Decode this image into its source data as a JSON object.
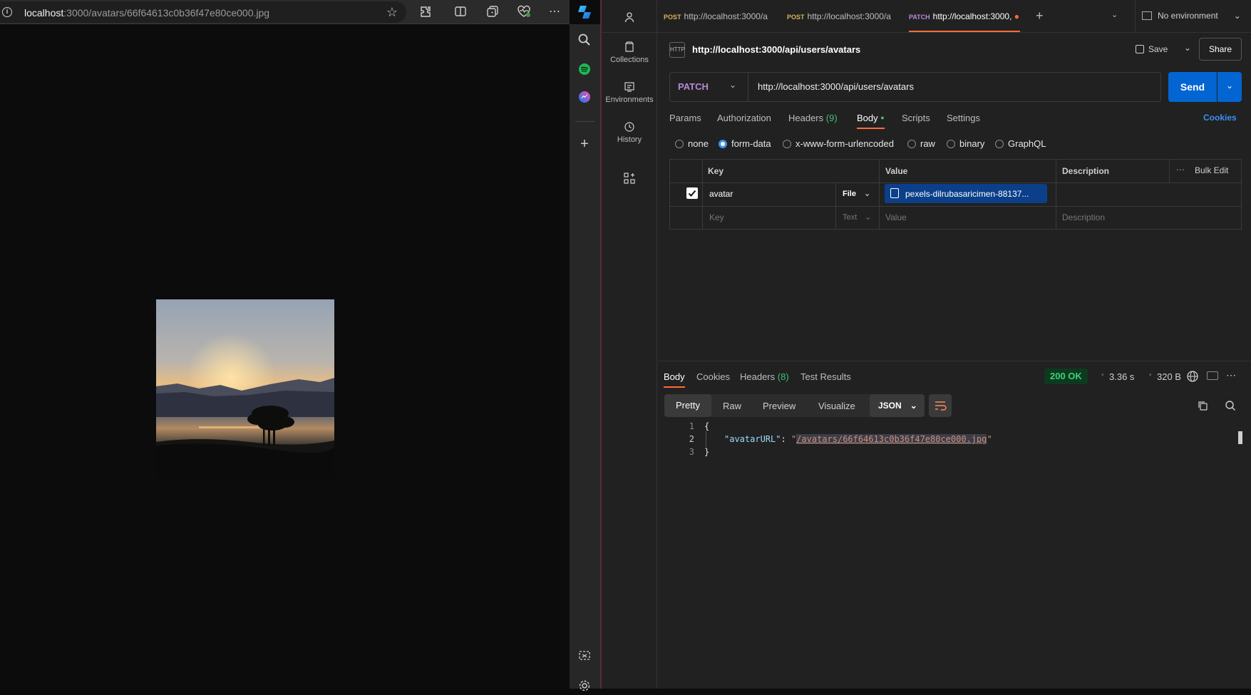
{
  "browser": {
    "url_host": "localhost",
    "url_rest": ":3000/avatars/66f64613c0b36f47e80ce000.jpg",
    "toolbar_icons": [
      "star-icon",
      "extensions-icon",
      "split-screen-icon",
      "collections-icon",
      "browser-essentials-icon",
      "more-icon",
      "copilot-icon"
    ],
    "sidebar_icons": [
      "search-icon",
      "spotify-icon",
      "messenger-icon",
      "add-icon",
      "screenshot-icon",
      "settings-icon"
    ]
  },
  "postman": {
    "leftnav": {
      "account_icon": "user-icon",
      "items": [
        {
          "label": "Collections",
          "icon": "collections-icon"
        },
        {
          "label": "Environments",
          "icon": "environments-icon"
        },
        {
          "label": "History",
          "icon": "history-icon"
        }
      ],
      "add_icon": "add-icon",
      "apps_icon": "apps-icon"
    },
    "tabs": [
      {
        "method": "POST",
        "url": "http://localhost:3000/a"
      },
      {
        "method": "POST",
        "url": "http://localhost:3000/a"
      },
      {
        "method": "PATCH",
        "url": "http://localhost:3000,",
        "active": true
      }
    ],
    "environment": "No environment",
    "request": {
      "title": "http://localhost:3000/api/users/avatars",
      "save_label": "Save",
      "share_label": "Share",
      "method": "PATCH",
      "url": "http://localhost:3000/api/users/avatars",
      "send_label": "Send"
    },
    "request_tabs": {
      "params": "Params",
      "authorization": "Authorization",
      "headers": "Headers",
      "headers_count": "(9)",
      "body": "Body",
      "scripts": "Scripts",
      "settings": "Settings",
      "cookies": "Cookies"
    },
    "body_modes": [
      "none",
      "form-data",
      "x-www-form-urlencoded",
      "raw",
      "binary",
      "GraphQL"
    ],
    "body_mode_selected": "form-data",
    "form_table": {
      "col_key": "Key",
      "col_value": "Value",
      "col_description": "Description",
      "bulk_edit": "Bulk Edit",
      "rows": [
        {
          "checked": true,
          "key": "avatar",
          "type": "File",
          "value": "pexels-dilrubasaricimen-88137...",
          "description": ""
        }
      ],
      "empty_row": {
        "key_placeholder": "Key",
        "type": "Text",
        "value_placeholder": "Value",
        "description_placeholder": "Description"
      }
    },
    "response": {
      "tabs": {
        "body": "Body",
        "cookies": "Cookies",
        "headers": "Headers",
        "headers_count": "(8)",
        "test_results": "Test Results"
      },
      "status": "200 OK",
      "time": "3.36 s",
      "size": "320 B",
      "view_tabs": [
        "Pretty",
        "Raw",
        "Preview",
        "Visualize"
      ],
      "format": "JSON",
      "lines": [
        "1",
        "2",
        "3"
      ],
      "code_open": "{",
      "code_key": "\"avatarURL\"",
      "code_colon": ": ",
      "code_value": "/avatars/66f64613c0b36f47e80ce000.jpg",
      "code_close": "}"
    }
  },
  "colors": {
    "accent_orange": "#ff6c37",
    "send_blue": "#0265d2",
    "status_green": "#0b7a2f",
    "link_blue": "#3d8ff0"
  }
}
